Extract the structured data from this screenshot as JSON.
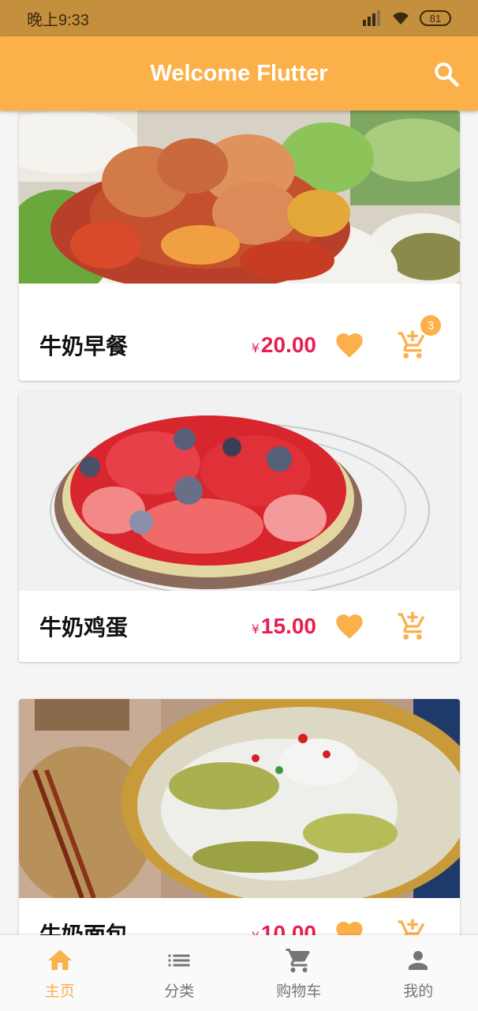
{
  "status": {
    "time": "晚上9:33",
    "battery": "81"
  },
  "appbar": {
    "title": "Welcome Flutter",
    "search_icon": "search-icon"
  },
  "products": [
    {
      "name": "牛奶早餐",
      "currency": "¥",
      "price": "20.00",
      "cart_badge": "3"
    },
    {
      "name": "牛奶鸡蛋",
      "currency": "¥",
      "price": "15.00"
    },
    {
      "name": "牛奶面包",
      "currency": "¥",
      "price": "10.00"
    }
  ],
  "colors": {
    "accent": "#fbb049",
    "price": "#e91e50",
    "statusbar": "#c5903e"
  },
  "nav": [
    {
      "label": "主页",
      "icon": "home-icon",
      "active": true
    },
    {
      "label": "分类",
      "icon": "list-icon"
    },
    {
      "label": "购物车",
      "icon": "cart-icon"
    },
    {
      "label": "我的",
      "icon": "person-icon"
    }
  ]
}
